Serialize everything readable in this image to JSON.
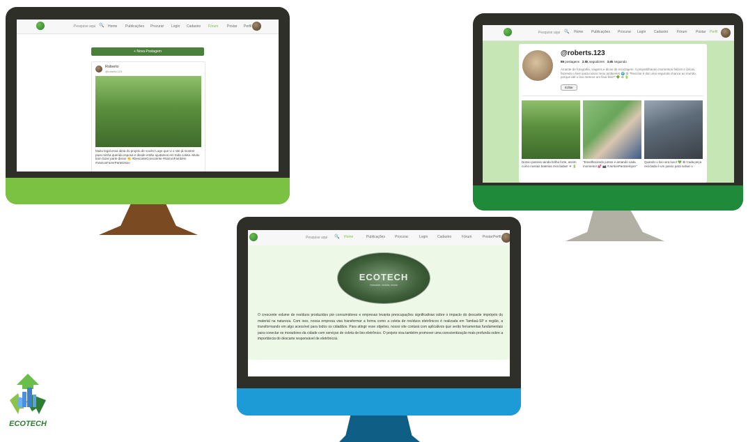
{
  "monitor_left": {
    "nav": {
      "search_placeholder": "Pesquise aqui",
      "items": [
        "Home",
        "Publicações",
        "Procurar",
        "Login",
        "Cadastro",
        "Fórum",
        "Postar",
        "Perfil"
      ]
    },
    "new_post_button": "+ Nova Postagem",
    "post": {
      "author": "Roberto",
      "handle": "@roberts.123",
      "caption": "Muito legal essa ideia do projeto de vocês! Logo que vi o site já mostrei para minha querida esposa e desde então ajudamos em toda coleta. Muito bom fazer parte disso! 👏 #DescarteConsciente #NósVoFambém #VamosFazerParteDisso"
    }
  },
  "monitor_right": {
    "nav": {
      "search_placeholder": "Pesquise aqui",
      "items": [
        "Home",
        "Publicações",
        "Procurar",
        "Login",
        "Cadastro",
        "Fórum",
        "Postar",
        "Perfil"
      ]
    },
    "profile": {
      "username": "@roberts.123",
      "posts_count": "89",
      "posts_label": "postagens",
      "followers_count": "2.5k",
      "followers_label": "seguidores",
      "following_count": "3.6k",
      "following_label": "seguindo",
      "bio": "Amante de fotografia, viagens e dicas de reciclagem. Compartilhando momentos felizes e óricas, fazendo o bem para nosso meio ambiente! 🌍 ♻ \"Reciclar é dar uma segunda chance ao mundo, porque até o lixo merece um final feliz!\" 🌳 ♻ 🔋",
      "edit_button": "Editar"
    },
    "gallery": [
      {
        "caption": "Nosso passeio ainda brilha forte, assim como nossas baterias recicladas! ☀ 🔋"
      },
      {
        "caption": "\"Envelhecendo juntos e amando cada momento! 💕 📷 #JuntosParaSempre\""
      },
      {
        "caption": "Quando o lixo vira luxo! 💚 ♻ Cada peça reciclada é um passo para salvar o"
      }
    ]
  },
  "monitor_bottom": {
    "nav": {
      "search_placeholder": "Pesquise aqui",
      "items": [
        "Home",
        "Publicações",
        "Procurar",
        "Login",
        "Cadastro",
        "Fórum",
        "Postar",
        "Perfil"
      ]
    },
    "hero": {
      "title": "ECOTECH",
      "subtitle": "Descartar, reciclar, inovar"
    },
    "description": "O crescente volume de resíduos produzidos por consumidores e empresas levanta preocupações significativas sobre o impacto do descarte impróprio do material na natureza. Com isso, nossa empresa visa transformar a forma como a coleta de resíduos eletrônicos é realizada em Tambaú-SP e região, a transformando em algo acessível para todos os cidadãos. Para atingir esse objetivo, nosso site contará com aplicativos que serão ferramentas fundamentais para conectar os moradores da cidade com serviços de coleta de lixo eletrônico. O projeto visa também promover uma conscientização mais profunda sobre a importância do descarte responsável de eletrônicos."
  },
  "brand": {
    "logo_text": "ECOTECH"
  },
  "colors": {
    "bezel": "#2f2f2a",
    "left_chin": "#7cc242",
    "left_stand": "#7a4a23",
    "right_chin": "#1e8a3a",
    "right_stand": "#b2b0a4",
    "bottom_chin": "#1d9bd6",
    "bottom_stand": "#0f5e86",
    "right_bg": "#c6e6b5",
    "bottom_bg": "#eef8e6",
    "green_button": "#4b7f3c",
    "active_nav": "#7cc242"
  }
}
